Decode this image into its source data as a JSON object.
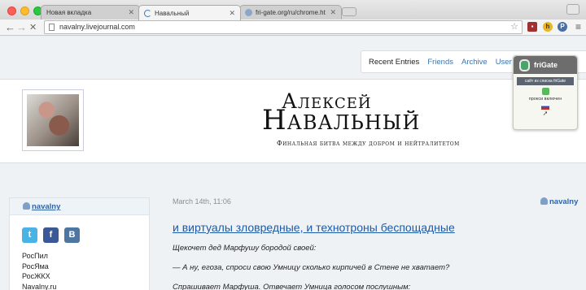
{
  "browser": {
    "tabs": [
      {
        "label": "Новая вкладка",
        "active": false
      },
      {
        "label": "Навальный",
        "active": true
      },
      {
        "label": "fri-gate.org/ru/chrome.ht",
        "active": false
      }
    ],
    "url": "navalny.livejournal.com"
  },
  "topnav": {
    "items": [
      "Recent Entries",
      "Friends",
      "Archive",
      "User I"
    ]
  },
  "header": {
    "title_line1": "Алексей",
    "title_line2": "Навальный",
    "tagline": "Финальная битва между добром и нейтралитетом"
  },
  "frigate": {
    "name": "friGate",
    "button": "сайт из списка friGate",
    "status": "прокси включен"
  },
  "sidebar": {
    "username": "navalny",
    "social": [
      "t",
      "f",
      "B"
    ],
    "links": [
      "РосПил",
      "РосЯма",
      "РосЖКХ",
      "Navalny.ru"
    ]
  },
  "post": {
    "date": "March 14th, 11:06",
    "author": "navalny",
    "title": "и виртуалы зловредные, и технотроны беспощадные",
    "paragraphs": [
      "Щекочет дед Марфушу бородой своей:",
      "— А ну, егоза, спроси свою Умницу сколько кирпичей в Стене не хватает?",
      "Спрашивает Марфуша. Отвечает Умница голосом послушным:"
    ]
  },
  "colors": {
    "link": "#3b73b0",
    "accent_green": "#4aa36a"
  }
}
